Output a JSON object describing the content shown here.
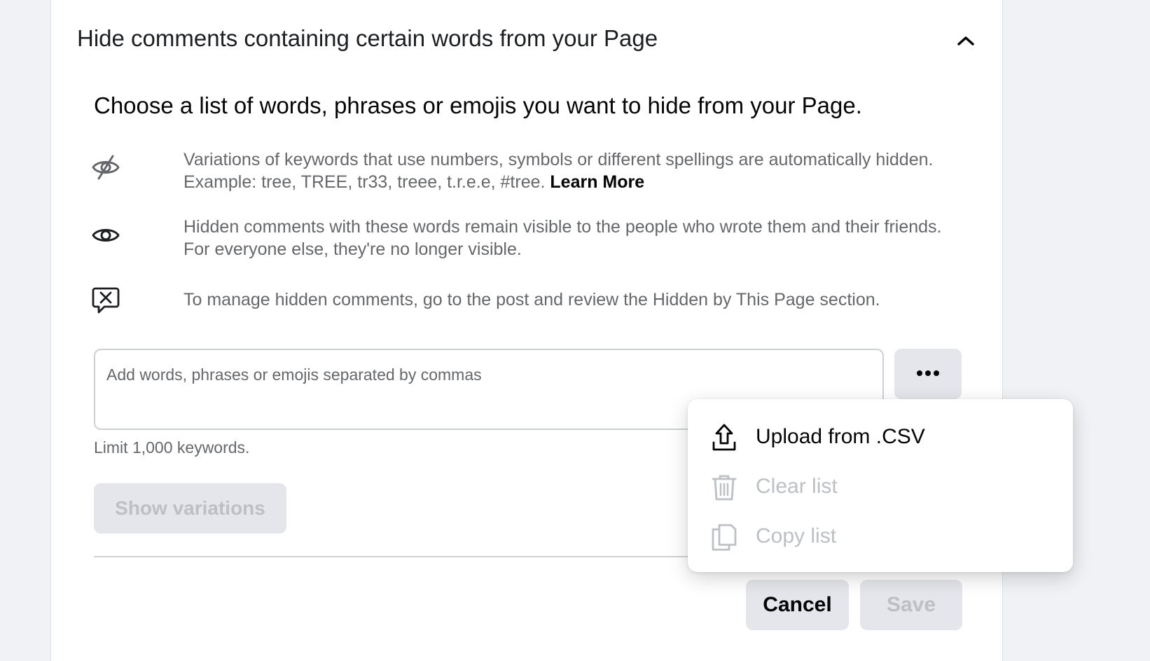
{
  "section": {
    "title": "Hide comments containing certain words from your Page",
    "collapse_icon": "chevron-up-icon"
  },
  "main": {
    "subtitle": "Choose a list of words, phrases or emojis you want to hide from your Page.",
    "info": [
      {
        "icon": "eye-slash-icon",
        "text": "Variations of keywords that use numbers, symbols or different spellings are automatically hidden. Example: tree, TREE, tr33, treee, t.r.e.e, #tree.",
        "link": "Learn More"
      },
      {
        "icon": "eye-icon",
        "text": "Hidden comments with these words remain visible to the people who wrote them and their friends. For everyone else, they're no longer visible."
      },
      {
        "icon": "comment-x-icon",
        "text": "To manage hidden comments, go to the post and review the Hidden by This Page section."
      }
    ],
    "keyword_input": {
      "placeholder": "Add words, phrases or emojis separated by commas",
      "value": ""
    },
    "more_button_icon": "more-horizontal-icon",
    "limit_text": "Limit 1,000 keywords.",
    "show_variations_label": "Show variations"
  },
  "dropdown": {
    "items": [
      {
        "label": "Upload from .CSV",
        "icon": "upload-icon",
        "enabled": true
      },
      {
        "label": "Clear list",
        "icon": "trash-icon",
        "enabled": false
      },
      {
        "label": "Copy list",
        "icon": "copy-icon",
        "enabled": false
      }
    ]
  },
  "footer": {
    "cancel_label": "Cancel",
    "save_label": "Save"
  },
  "colors": {
    "background": "#f0f2f5",
    "panel": "#ffffff",
    "button_gray": "#e4e6eb",
    "disabled_text": "#bcc0c4",
    "secondary_text": "#65676b"
  }
}
